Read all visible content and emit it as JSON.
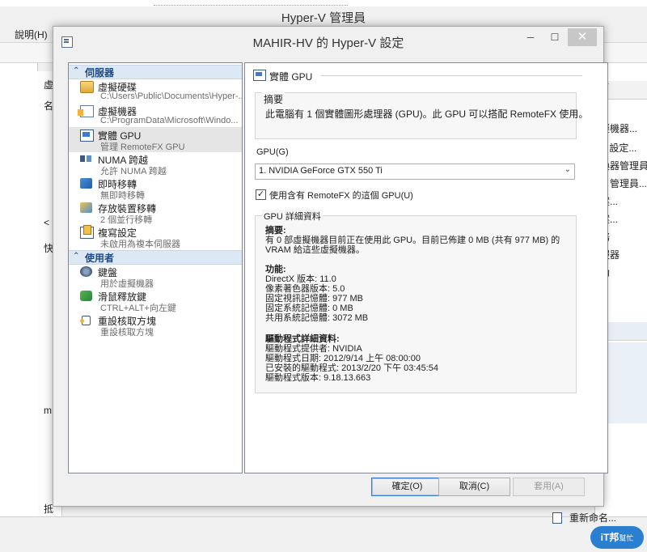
{
  "background_window": {
    "title": "Hyper-V 管理員",
    "menu_help": "說明(H)",
    "left_fragments": [
      "虛",
      "名",
      "<",
      "快",
      "m",
      "抵"
    ],
    "right_header": "V",
    "right_actions": [
      "擬機器...",
      "V 設定...",
      "換器管理員...",
      "N 管理員...",
      "案...",
      "案...",
      "務",
      "服器",
      "助",
      "重新命名..."
    ]
  },
  "watermark": {
    "text": "iT邦",
    "sub": "幫忙"
  },
  "dialog": {
    "title": "MAHIR-HV 的 Hyper-V 設定",
    "buttons": {
      "minimize": "─",
      "maximize": "☐",
      "close": "✕"
    },
    "tree": {
      "sections": [
        {
          "label": "伺服器",
          "chevron": "⌃"
        },
        {
          "label": "使用者",
          "chevron": "⌃"
        }
      ],
      "server_items": [
        {
          "title": "虛擬硬碟",
          "sub": "C:\\Users\\Public\\Documents\\Hyper-...",
          "icon": "disk-icon"
        },
        {
          "title": "虛擬機器",
          "sub": "C:\\ProgramData\\Microsoft\\Windo...",
          "icon": "folder-doc-icon"
        },
        {
          "title": "實體 GPU",
          "sub": "管理 RemoteFX GPU",
          "icon": "gpu-icon"
        },
        {
          "title": "NUMA 跨越",
          "sub": "允許 NUMA 跨越",
          "icon": "numa-icon"
        },
        {
          "title": "即時移轉",
          "sub": "無即時移轉",
          "icon": "live-migration-icon"
        },
        {
          "title": "存放裝置移轉",
          "sub": "2 個並行移轉",
          "icon": "storage-migration-icon"
        },
        {
          "title": "複寫設定",
          "sub": "未啟用為複本伺服器",
          "icon": "replication-icon"
        }
      ],
      "user_items": [
        {
          "title": "鍵盤",
          "sub": "用於虛擬機器",
          "icon": "keyboard-icon"
        },
        {
          "title": "滑鼠釋放鍵",
          "sub": "CTRL+ALT+向左鍵",
          "icon": "mouse-icon"
        },
        {
          "title": "重設核取方塊",
          "sub": "重設核取方塊",
          "icon": "reset-icon"
        }
      ]
    },
    "panel": {
      "heading": "實體 GPU",
      "summary_title": "摘要",
      "summary_text": "此電腦有 1 個實體圖形處理器 (GPU)。此 GPU 可以搭配 RemoteFX 使用。",
      "gpu_label": "GPU(G)",
      "gpu_selected": "1. NVIDIA GeForce GTX 550 Ti",
      "checkbox_label": "使用含有 RemoteFX 的這個 GPU(U)",
      "checkbox_checked": "✓",
      "detail_title": "GPU 詳細資料",
      "detail_summary_head": "摘要:",
      "detail_summary_1": "有 0 部虛擬機器目前正在使用此 GPU。目前已佈建 0 MB (共有 977 MB) 的",
      "detail_summary_2": "VRAM 給這些虛擬機器。",
      "features_head": "功能:",
      "features": [
        "DirectX 版本: 11.0",
        "像素著色器版本: 5.0",
        "固定視訊記憶體: 977 MB",
        "固定系統記憶體: 0 MB",
        "共用系統記憶體: 3072 MB"
      ],
      "driver_head": "驅動程式詳細資料:",
      "driver": [
        "驅動程式提供者: NVIDIA",
        "驅動程式日期: 2012/9/14 上午 08:00:00",
        "已安裝的驅動程式: 2013/2/20 下午 03:45:54",
        "驅動程式版本: 9.18.13.663"
      ]
    },
    "footer": {
      "ok": "確定(O)",
      "cancel": "取消(C)",
      "apply": "套用(A)"
    }
  }
}
